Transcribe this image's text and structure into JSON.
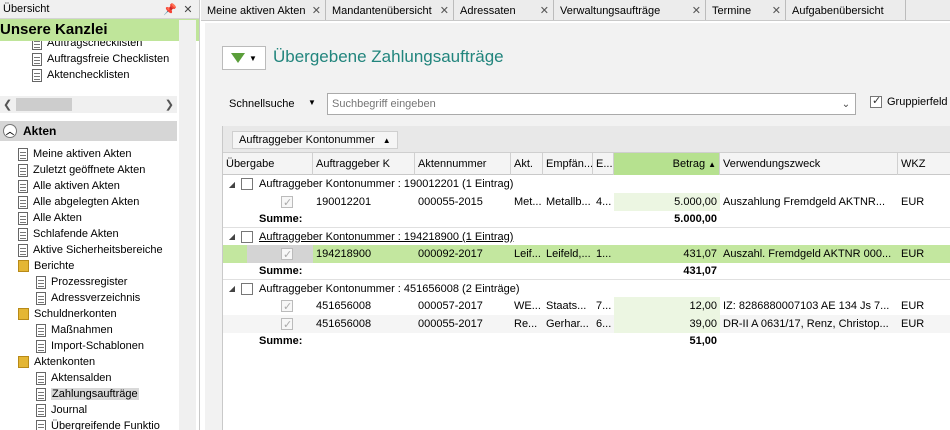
{
  "left_panel": {
    "title": "Übersicht",
    "pin_icon": "pin-icon",
    "close_icon": "close-icon",
    "header": "Unsere Kanzlei",
    "top_items": [
      {
        "label": "Auftragschecklisten"
      },
      {
        "label": "Auftragsfreie Checklisten"
      },
      {
        "label": "Aktenchecklisten"
      }
    ],
    "section": "Akten",
    "tree": [
      {
        "label": "Meine aktiven Akten",
        "indent": 0,
        "icon": "document-icon"
      },
      {
        "label": "Zuletzt geöffnete Akten",
        "indent": 0,
        "icon": "document-icon"
      },
      {
        "label": "Alle aktiven Akten",
        "indent": 0,
        "icon": "document-icon"
      },
      {
        "label": "Alle abgelegten Akten",
        "indent": 0,
        "icon": "document-icon"
      },
      {
        "label": "Alle Akten",
        "indent": 0,
        "icon": "document-icon"
      },
      {
        "label": "Schlafende Akten",
        "indent": 0,
        "icon": "document-icon"
      },
      {
        "label": "Aktive Sicherheitsbereiche",
        "indent": 0,
        "icon": "document-icon"
      },
      {
        "label": "Berichte",
        "indent": 0,
        "icon": "folder-icon"
      },
      {
        "label": "Prozessregister",
        "indent": 1,
        "icon": "document-icon"
      },
      {
        "label": "Adressverzeichnis",
        "indent": 1,
        "icon": "document-icon"
      },
      {
        "label": "Schuldnerkonten",
        "indent": 0,
        "icon": "folder-icon"
      },
      {
        "label": "Maßnahmen",
        "indent": 1,
        "icon": "document-icon"
      },
      {
        "label": "Import-Schablonen",
        "indent": 1,
        "icon": "document-icon"
      },
      {
        "label": "Aktenkonten",
        "indent": 0,
        "icon": "folder-icon"
      },
      {
        "label": "Aktensalden",
        "indent": 1,
        "icon": "document-icon"
      },
      {
        "label": "Zahlungsaufträge",
        "indent": 1,
        "icon": "document-icon",
        "selected": true
      },
      {
        "label": "Journal",
        "indent": 1,
        "icon": "document-icon"
      },
      {
        "label": "Übergreifende Funktio",
        "indent": 1,
        "icon": "document-icon"
      }
    ]
  },
  "tabs": [
    {
      "label": "Meine aktiven Akten"
    },
    {
      "label": "Mandantenübersicht"
    },
    {
      "label": "Adressaten"
    },
    {
      "label": "Verwaltungsaufträge"
    },
    {
      "label": "Termine"
    },
    {
      "label": "Aufgabenübersicht"
    }
  ],
  "page": {
    "title": "Übergebene Zahlungsaufträge",
    "filter_icon": "filter-icon",
    "quicksearch_label": "Schnellsuche",
    "search_placeholder": "Suchbegriff eingeben",
    "group_checkbox_label": "Gruppierfeld",
    "group_checked": true
  },
  "grid": {
    "group_chip": "Auftraggeber Kontonummer",
    "columns": [
      {
        "label": "Übergabe"
      },
      {
        "label": "Auftraggeber K"
      },
      {
        "label": "Aktennummer"
      },
      {
        "label": "Akt."
      },
      {
        "label": "Empfän..."
      },
      {
        "label": "E..."
      },
      {
        "label": "Betrag"
      },
      {
        "label": "Verwendungszweck"
      },
      {
        "label": "WKZ"
      }
    ],
    "sort_column": "Betrag",
    "accent_color": "#b6e18f",
    "groups": [
      {
        "header": "Auftraggeber Kontonummer : 190012201 (1 Eintrag)",
        "rows": [
          {
            "konto": "190012201",
            "akte": "000055-2015",
            "akt": "Met...",
            "empf": "Metallb...",
            "e": "4...",
            "betrag": "5.000,00",
            "zweck": "Auszahlung Fremdgeld AKTNR...",
            "wkz": "EUR"
          }
        ],
        "sum_label": "Summe:",
        "sum": "5.000,00"
      },
      {
        "header": "Auftraggeber Kontonummer : 194218900 (1 Eintrag)",
        "rows": [
          {
            "konto": "194218900",
            "akte": "000092-2017",
            "akt": "Leif...",
            "empf": "Leifeld,...",
            "e": "1...",
            "betrag": "431,07",
            "zweck": "Auszahl. Fremdgeld AKTNR 000...",
            "wkz": "EUR",
            "selected": true
          }
        ],
        "sum_label": "Summe:",
        "sum": "431,07"
      },
      {
        "header": "Auftraggeber Kontonummer : 451656008 (2 Einträge)",
        "rows": [
          {
            "konto": "451656008",
            "akte": "000057-2017",
            "akt": "WE...",
            "empf": "Staats...",
            "e": "7...",
            "betrag": "12,00",
            "zweck": "IZ: 8286880007103 AE 134 Js 7...",
            "wkz": "EUR"
          },
          {
            "konto": "451656008",
            "akte": "000055-2017",
            "akt": "Re...",
            "empf": "Gerhar...",
            "e": "6...",
            "betrag": "39,00",
            "zweck": "DR-II A 0631/17, Renz, Christop...",
            "wkz": "EUR"
          }
        ],
        "sum_label": "Summe:",
        "sum": "51,00"
      }
    ]
  }
}
